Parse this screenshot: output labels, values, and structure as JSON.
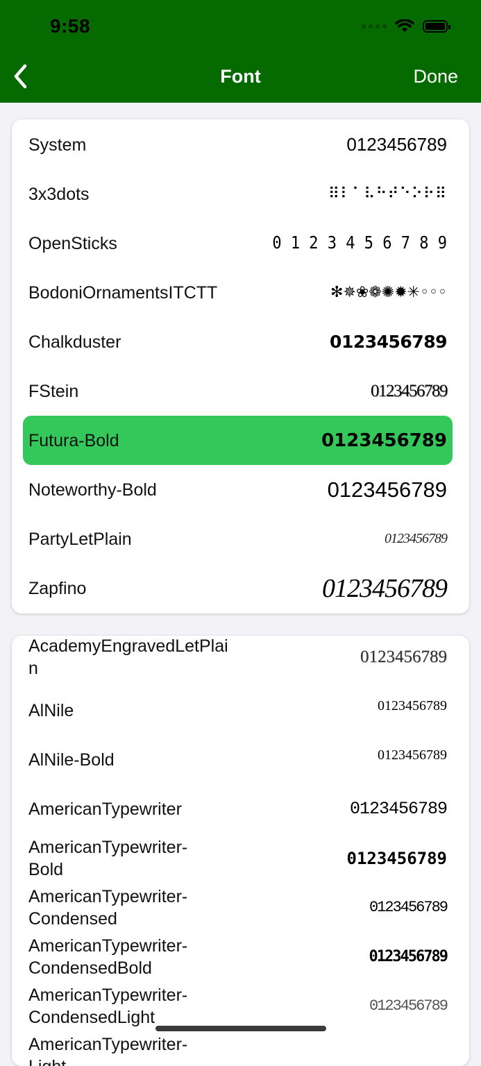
{
  "status": {
    "time": "9:58"
  },
  "nav": {
    "title": "Font",
    "done": "Done"
  },
  "fonts_primary": [
    {
      "name": "System",
      "sample": "0123456789"
    },
    {
      "name": "3x3dots",
      "sample": "⠿⠇⠁⠧⠓⠞⠑⠕⠗⠿"
    },
    {
      "name": "OpenSticks",
      "sample": "0 1 2 3 4 5 6 7 8 9"
    },
    {
      "name": "BodoniOrnamentsITCTT",
      "sample": "✻✵❀❁✺✹✳◦◦◦"
    },
    {
      "name": "Chalkduster",
      "sample": "0123456789"
    },
    {
      "name": "FStein",
      "sample": "0123456789"
    },
    {
      "name": "Futura-Bold",
      "sample": "0123456789",
      "selected": true
    },
    {
      "name": "Noteworthy-Bold",
      "sample": "0123456789"
    },
    {
      "name": "PartyLetPlain",
      "sample": "0123456789"
    },
    {
      "name": "Zapfino",
      "sample": "0123456789"
    }
  ],
  "fonts_all": [
    {
      "name": "AcademyEngravedLetPlain",
      "sample": "0123456789"
    },
    {
      "name": "AlNile",
      "sample": "0123456789"
    },
    {
      "name": "AlNile-Bold",
      "sample": "0123456789"
    },
    {
      "name": "AmericanTypewriter",
      "sample": "0123456789"
    },
    {
      "name": "AmericanTypewriter-Bold",
      "sample": "0123456789"
    },
    {
      "name": "AmericanTypewriter-Condensed",
      "sample": "0123456789"
    },
    {
      "name": "AmericanTypewriter-CondensedBold",
      "sample": "0123456789"
    },
    {
      "name": "AmericanTypewriter-CondensedLight",
      "sample": "0123456789"
    },
    {
      "name": "AmericanTypewriter-Light",
      "sample": ""
    }
  ],
  "colors": {
    "header": "#056b00",
    "selected": "#34c759"
  }
}
